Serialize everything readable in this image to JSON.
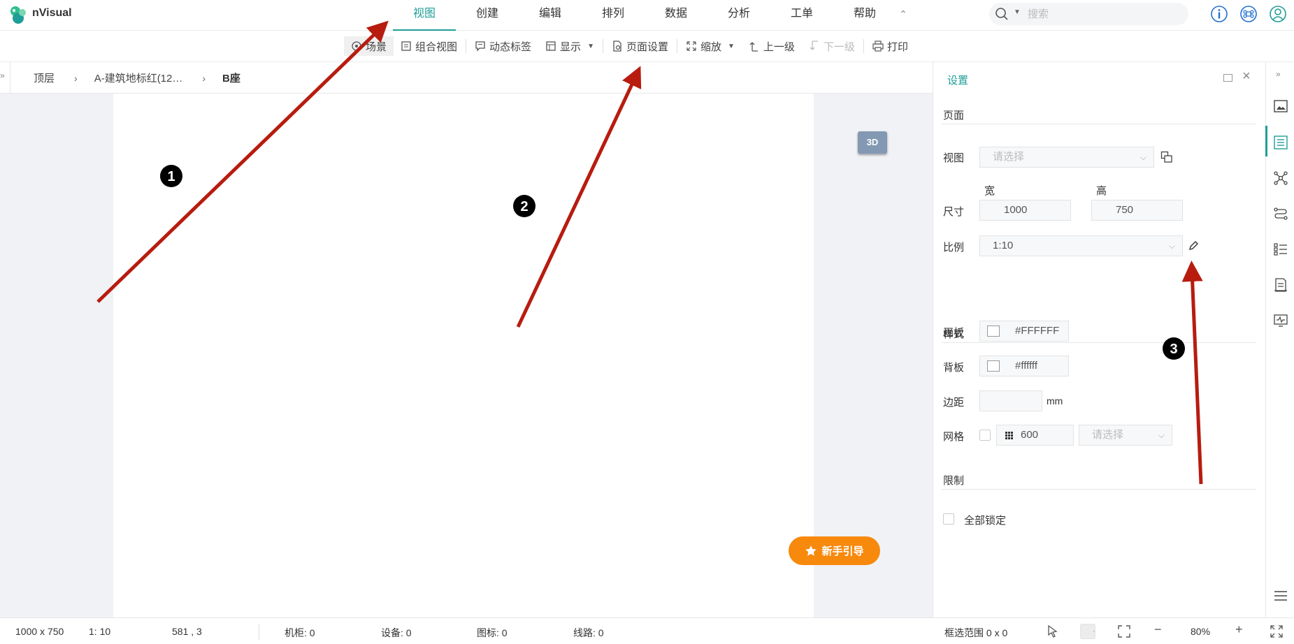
{
  "app": {
    "brand": "nVisual"
  },
  "menu": {
    "items": [
      {
        "label": "视图",
        "active": true
      },
      {
        "label": "创建"
      },
      {
        "label": "编辑"
      },
      {
        "label": "排列"
      },
      {
        "label": "数据"
      },
      {
        "label": "分析"
      },
      {
        "label": "工单"
      },
      {
        "label": "帮助"
      }
    ]
  },
  "search": {
    "placeholder": "搜索"
  },
  "toolbar": {
    "scene": "场景",
    "combo_view": "组合视图",
    "dynamic_label": "动态标签",
    "display": "显示",
    "page_settings": "页面设置",
    "zoom": "缩放",
    "up_level": "上一级",
    "down_level": "下一级",
    "print": "打印"
  },
  "breadcrumb": {
    "items": [
      "顶层",
      "A-建筑地标红(12…",
      "B座"
    ]
  },
  "canvas": {
    "btn_3d": "3D",
    "guide": "新手引导"
  },
  "settings": {
    "title": "设置",
    "section_page": "页面",
    "view_label": "视图",
    "view_placeholder": "请选择",
    "width_label": "宽",
    "height_label": "高",
    "size_label": "尺寸",
    "width_value": "1000",
    "height_value": "750",
    "scale_label": "比例",
    "scale_value": "1:10",
    "section_style": "样式",
    "canvas_label": "画板",
    "canvas_color": "#FFFFFF",
    "bg_label": "背板",
    "bg_color": "#ffffff",
    "margin_label": "边距",
    "margin_unit": "mm",
    "grid_label": "网格",
    "grid_value": "600",
    "grid_placeholder": "请选择",
    "section_limit": "限制",
    "lock_all": "全部锁定"
  },
  "status": {
    "page_size": "1000 x 750",
    "scale": "1: 10",
    "coords": "581 , 3",
    "racks": "机柜: 0",
    "devices": "设备: 0",
    "icons": "图标: 0",
    "lines": "线路: 0",
    "selection": "框选范围  0 x 0",
    "zoom": "80%"
  },
  "annotations": {
    "marker_1": "1",
    "marker_2": "2",
    "marker_3": "3",
    "color": "#b71c0f"
  },
  "colors": {
    "accent": "#1f9e98",
    "guide": "#f7890d",
    "btn_3d": "#8399b3"
  }
}
